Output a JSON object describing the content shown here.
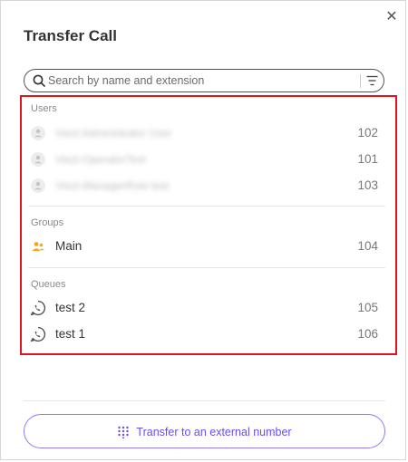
{
  "dialog": {
    "title": "Transfer Call",
    "close_icon": "close-icon"
  },
  "search": {
    "placeholder": "Search by name and extension",
    "value": ""
  },
  "sections": {
    "users": {
      "label": "Users",
      "items": [
        {
          "name": "Viezt Administrator User",
          "ext": "102"
        },
        {
          "name": "Viezt-OperatorTest",
          "ext": "101"
        },
        {
          "name": "Viezt-ManagerRole test",
          "ext": "103"
        }
      ]
    },
    "groups": {
      "label": "Groups",
      "items": [
        {
          "name": "Main",
          "ext": "104"
        }
      ]
    },
    "queues": {
      "label": "Queues",
      "items": [
        {
          "name": "test 2",
          "ext": "105"
        },
        {
          "name": "test 1",
          "ext": "106"
        }
      ]
    }
  },
  "footer": {
    "external_button_label": "Transfer to an external number"
  },
  "colors": {
    "accent": "#6a4df0",
    "highlight": "#e0141e",
    "group_icon": "#f5a623"
  }
}
